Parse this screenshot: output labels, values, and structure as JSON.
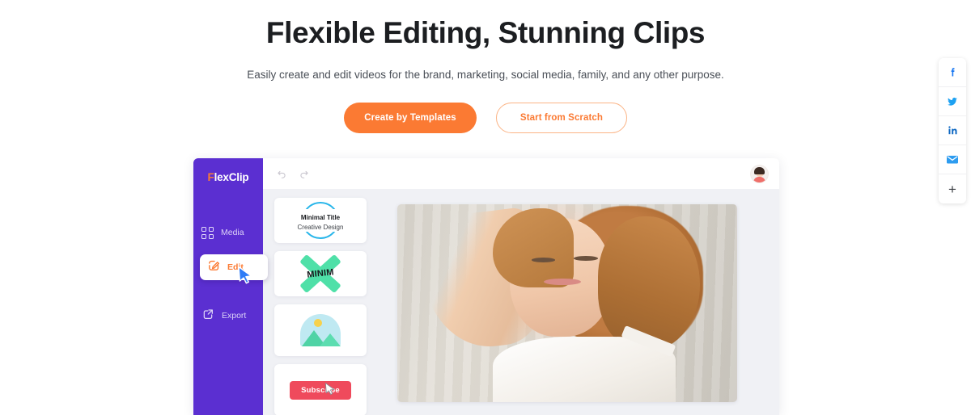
{
  "hero": {
    "title": "Flexible Editing, Stunning Clips",
    "subtitle": "Easily create and edit videos for the brand, marketing, social media, family, and any other purpose.",
    "primary_cta": "Create by Templates",
    "secondary_cta": "Start from Scratch"
  },
  "colors": {
    "accent_orange": "#fb7a33",
    "sidebar_purple": "#5b2fd1",
    "editor_bg": "#f0f1f5",
    "facebook_blue": "#1877f2",
    "twitter_blue": "#1da1f2",
    "linkedin_blue": "#0a66c2",
    "email_blue": "#2d9cf0",
    "subscribe_red": "#ef4a5c",
    "ring_cyan": "#29b6ea",
    "brush_green": "#4fe0a8"
  },
  "social_rail": {
    "items": [
      {
        "name": "facebook",
        "icon": "facebook-icon",
        "label": "f"
      },
      {
        "name": "twitter",
        "icon": "twitter-icon",
        "label": ""
      },
      {
        "name": "linkedin",
        "icon": "linkedin-icon",
        "label": "in"
      },
      {
        "name": "email",
        "icon": "email-icon",
        "label": ""
      },
      {
        "name": "more",
        "icon": "plus-icon",
        "label": "+"
      }
    ]
  },
  "app": {
    "logo": {
      "initial": "F",
      "rest": "lexClip"
    },
    "toolbar": {
      "undo_icon": "undo-icon",
      "redo_icon": "redo-icon",
      "avatar_icon": "user-avatar"
    },
    "sidebar": {
      "items": [
        {
          "label": "Media",
          "icon": "grid-icon",
          "active": false
        },
        {
          "label": "Edit",
          "icon": "pencil-square-icon",
          "active": true
        },
        {
          "label": "Export",
          "icon": "export-icon",
          "active": false
        }
      ]
    },
    "templates": [
      {
        "name": "minimal-title-card",
        "line1": "Minimal Title",
        "line2": "Creative Design",
        "style": "ring"
      },
      {
        "name": "minim-brush-card",
        "text": "MINIM",
        "style": "brush-x"
      },
      {
        "name": "image-placeholder-card",
        "text": "",
        "style": "landscape"
      },
      {
        "name": "subscribe-card",
        "text": "Subscribe",
        "style": "button"
      }
    ],
    "preview": {
      "name": "video-preview",
      "description": "Smiling woman with curly auburn hair in a white top"
    },
    "cursors": [
      {
        "name": "cursor-on-edit",
        "color": "#2f7cf6"
      },
      {
        "name": "cursor-on-subscribe",
        "color": "#ffffff"
      }
    ]
  }
}
